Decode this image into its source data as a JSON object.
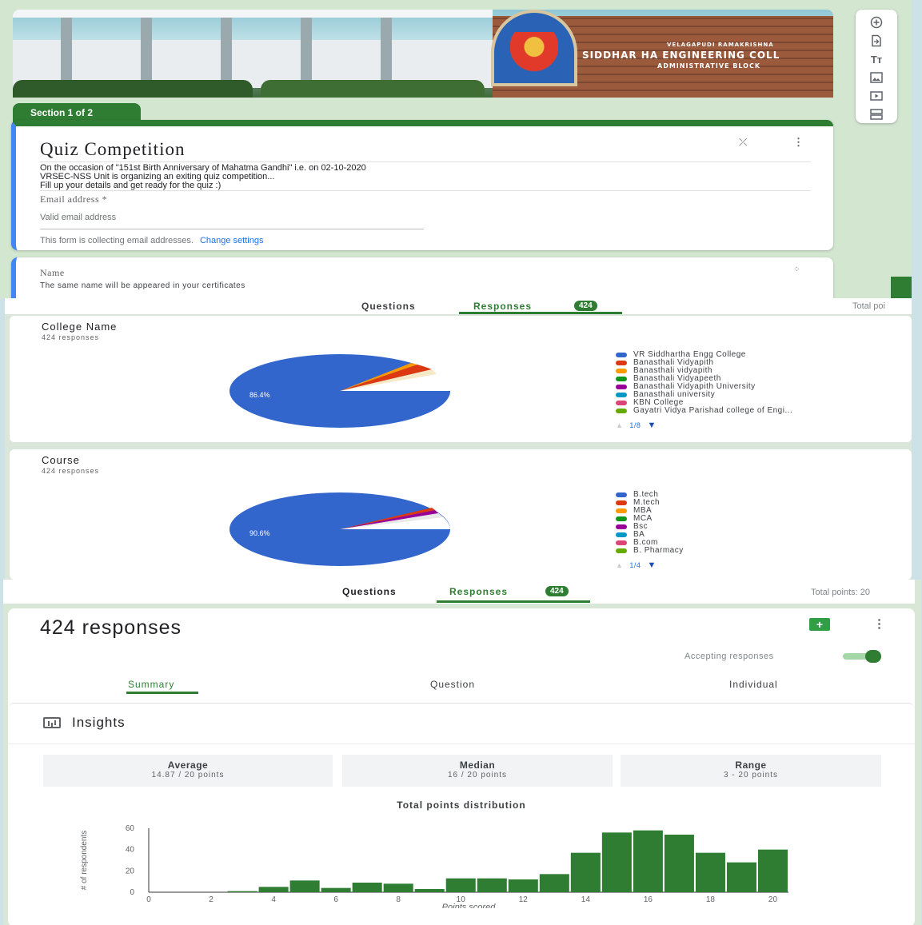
{
  "form": {
    "section_tab": "Section 1 of 2",
    "title": "Quiz Competition",
    "description": [
      "On the occasion of \"151st Birth Anniversary of Mahatma Gandhi\" i.e. on 02-10-2020",
      "VRSEC-NSS Unit is organizing an exiting quiz competition...",
      "Fill up your details and get ready for the quiz :)"
    ],
    "email_label": "Email address *",
    "email_placeholder": "Valid email address",
    "collecting_note": "This form is collecting email addresses.",
    "change_settings": "Change settings",
    "name_label": "Name",
    "name_hint": "The same name will be appeared in your certificates",
    "banner_text": "SIDDHAR  HA ENGINEERING COLL",
    "banner_sub1": "VELAGAPUDI RAMAKRISHNA",
    "banner_sub2": "ADMINISTRATIVE BLOCK"
  },
  "toolbar_icons": [
    "add-question-icon",
    "import-questions-icon",
    "add-title-icon",
    "add-image-icon",
    "add-video-icon",
    "add-section-icon"
  ],
  "tabs": {
    "questions": "Questions",
    "responses": "Responses",
    "count": "424",
    "total_points": "Total points: 20",
    "total_points_cut": "Total poi"
  },
  "college_chart": {
    "title": "College Name",
    "subtitle": "424 responses",
    "main_label": "86.4%",
    "legend": [
      {
        "label": "VR Siddhartha Engg College",
        "color": "#3366cc"
      },
      {
        "label": "Banasthali Vidyapith",
        "color": "#dc3912"
      },
      {
        "label": "Banasthali vidyapith",
        "color": "#ff9900"
      },
      {
        "label": "Banasthali Vidyapeeth",
        "color": "#109618"
      },
      {
        "label": "Banasthali Vidyapith University",
        "color": "#990099"
      },
      {
        "label": "Banasthali university",
        "color": "#0099c6"
      },
      {
        "label": "KBN College",
        "color": "#dd4477"
      },
      {
        "label": "Gayatri Vidya Parishad college of Engi...",
        "color": "#66aa00"
      }
    ],
    "pager": "1/8"
  },
  "course_chart": {
    "title": "Course",
    "subtitle": "424 responses",
    "main_label": "90.6%",
    "legend": [
      {
        "label": "B.tech",
        "color": "#3366cc"
      },
      {
        "label": "M.tech",
        "color": "#dc3912"
      },
      {
        "label": "MBA",
        "color": "#ff9900"
      },
      {
        "label": "MCA",
        "color": "#109618"
      },
      {
        "label": "Bsc",
        "color": "#990099"
      },
      {
        "label": "BA",
        "color": "#0099c6"
      },
      {
        "label": "B.com",
        "color": "#dd4477"
      },
      {
        "label": "B. Pharmacy",
        "color": "#66aa00"
      }
    ],
    "pager": "1/4"
  },
  "summary": {
    "responses": "424 responses",
    "accepting": "Accepting responses",
    "tab_summary": "Summary",
    "tab_question": "Question",
    "tab_individual": "Individual"
  },
  "insights": {
    "title": "Insights",
    "average_label": "Average",
    "average_value": "14.87 / 20 points",
    "median_label": "Median",
    "median_value": "16 / 20 points",
    "range_label": "Range",
    "range_value": "3 - 20 points",
    "dist_title": "Total points distribution"
  },
  "colors": {
    "accent": "#2f7d32",
    "blue": "#4285f4",
    "bar": "#2e7d32"
  },
  "chart_data": {
    "type": "bar",
    "title": "Total points distribution",
    "xlabel": "Points scored",
    "ylabel": "# of respondents",
    "x": [
      3,
      4,
      5,
      6,
      7,
      8,
      9,
      10,
      11,
      12,
      13,
      14,
      15,
      16,
      17,
      18,
      19,
      20
    ],
    "values": [
      1,
      5,
      11,
      4,
      9,
      8,
      3,
      13,
      13,
      12,
      17,
      37,
      56,
      58,
      54,
      37,
      28,
      40
    ],
    "xlim": [
      0,
      20.5
    ],
    "ylim": [
      0,
      60
    ],
    "x_ticks": [
      0,
      2,
      4,
      6,
      8,
      10,
      12,
      14,
      16,
      18,
      20
    ],
    "y_ticks": [
      0,
      20,
      40,
      60
    ]
  }
}
